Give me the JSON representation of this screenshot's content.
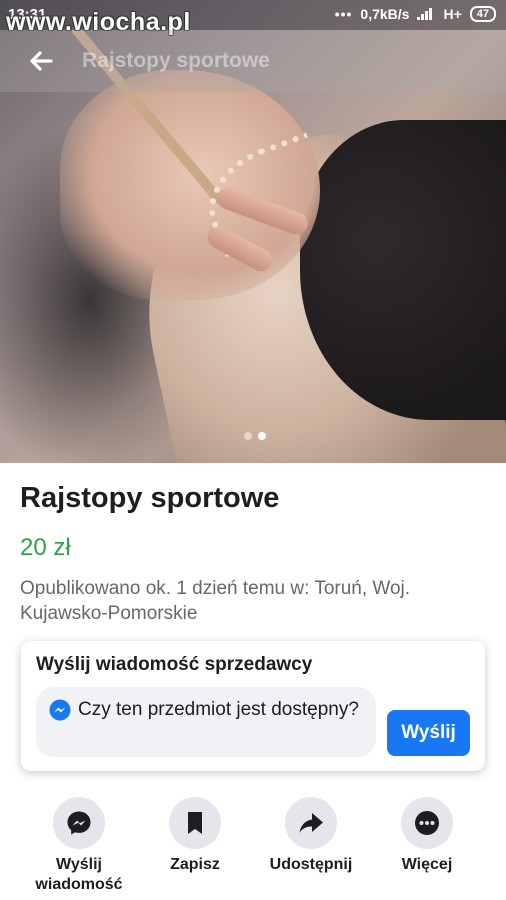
{
  "status_bar": {
    "time": "13:31",
    "dots": "•••",
    "network_speed": "0,7kB/s",
    "network_type": "H+",
    "battery": "47"
  },
  "watermark": "www.wiocha.pl",
  "header": {
    "title": "Rajstopy sportowe",
    "back_icon": "arrow-left-icon"
  },
  "gallery": {
    "current_page": 2,
    "total_pages": 2
  },
  "listing": {
    "title": "Rajstopy sportowe",
    "price": "20 zł",
    "meta": "Opublikowano ok. 1 dzień temu w: Toruń, Woj. Kujawsko-Pomorskie"
  },
  "message_card": {
    "title": "Wyślij wiadomość sprzedawcy",
    "message": "Czy ten przedmiot jest dostępny?",
    "send_label": "Wyślij",
    "messenger_icon": "messenger-icon"
  },
  "actions": [
    {
      "label": "Wyślij wiadomość",
      "icon": "messenger-icon"
    },
    {
      "label": "Zapisz",
      "icon": "bookmark-icon"
    },
    {
      "label": "Udostępnij",
      "icon": "share-icon"
    },
    {
      "label": "Więcej",
      "icon": "more-icon"
    }
  ],
  "colors": {
    "price": "#31a24c",
    "accent": "#1877f2",
    "action_circle": "#e4e6eb"
  }
}
